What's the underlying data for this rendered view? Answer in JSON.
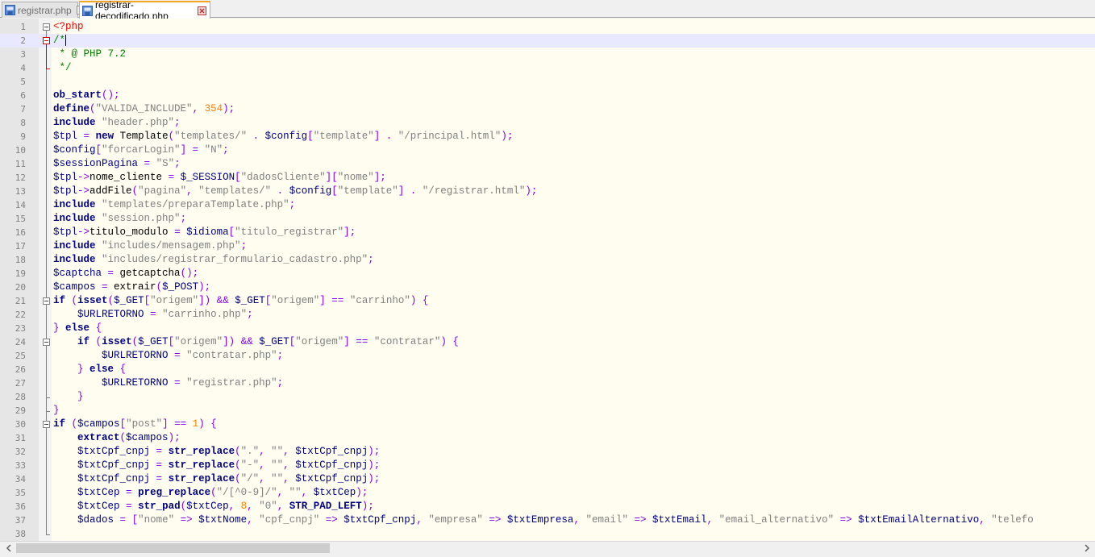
{
  "tabs": [
    {
      "label": "registrar.php",
      "active": false
    },
    {
      "label": "registrar-decodificado.php",
      "active": true
    }
  ],
  "editor": {
    "current_line": 2,
    "lines": [
      "<?php",
      "/*",
      " * @ PHP 7.2",
      " */",
      "",
      "ob_start();",
      "define(\"VALIDA_INCLUDE\", 354);",
      "include \"header.php\";",
      "$tpl = new Template(\"templates/\" . $config[\"template\"] . \"/principal.html\");",
      "$config[\"forcarLogin\"] = \"N\";",
      "$sessionPagina = \"S\";",
      "$tpl->nome_cliente = $_SESSION[\"dadosCliente\"][\"nome\"];",
      "$tpl->addFile(\"pagina\", \"templates/\" . $config[\"template\"] . \"/registrar.html\");",
      "include \"templates/preparaTemplate.php\";",
      "include \"session.php\";",
      "$tpl->titulo_modulo = $idioma[\"titulo_registrar\"];",
      "include \"includes/mensagem.php\";",
      "include \"includes/registrar_formulario_cadastro.php\";",
      "$captcha = getcaptcha();",
      "$campos = extrair($_POST);",
      "if (isset($_GET[\"origem\"]) && $_GET[\"origem\"] == \"carrinho\") {",
      "    $URLRETORNO = \"carrinho.php\";",
      "} else {",
      "    if (isset($_GET[\"origem\"]) && $_GET[\"origem\"] == \"contratar\") {",
      "        $URLRETORNO = \"contratar.php\";",
      "    } else {",
      "        $URLRETORNO = \"registrar.php\";",
      "    }",
      "}",
      "if ($campos[\"post\"] == 1) {",
      "    extract($campos);",
      "    $txtCpf_cnpj = str_replace(\".\", \"\", $txtCpf_cnpj);",
      "    $txtCpf_cnpj = str_replace(\"-\", \"\", $txtCpf_cnpj);",
      "    $txtCpf_cnpj = str_replace(\"/\", \"\", $txtCpf_cnpj);",
      "    $txtCep = preg_replace(\"/[^0-9]/\", \"\", $txtCep);",
      "    $txtCep = str_pad($txtCep, 8, \"0\", STR_PAD_LEFT);",
      "    $dados = [\"nome\" => $txtNome, \"cpf_cnpj\" => $txtCpf_cnpj, \"empresa\" => $txtEmpresa, \"email\" => $txtEmail, \"email_alternativo\" => $txtEmailAlternativo, \"telefo",
      ""
    ]
  },
  "colors": {
    "editor_bg": "#fefdf0",
    "current_line_bg": "#e8e8ff",
    "keyword": "#000080",
    "string": "#808080",
    "number": "#ff8000",
    "operator": "#8000ff",
    "php_tag": "#ff0000",
    "comment": "#008000"
  },
  "icons": {
    "file_icon": "file-icon",
    "close_icon": "close-icon",
    "scroll_left": "chevron-left-icon",
    "scroll_right": "chevron-right-icon"
  }
}
